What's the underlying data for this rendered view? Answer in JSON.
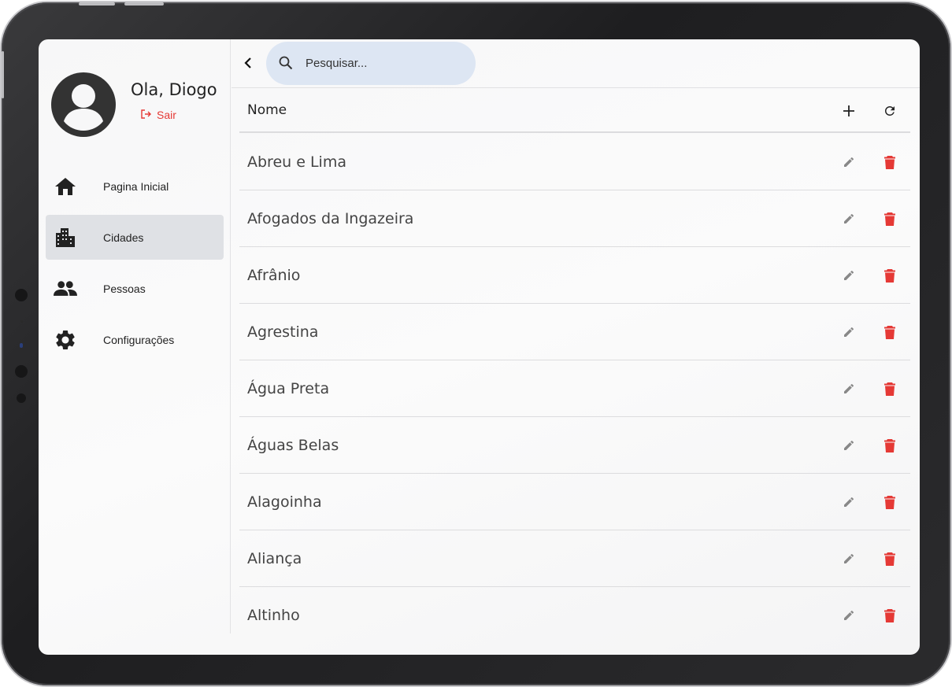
{
  "user": {
    "greeting": "Ola, Diogo",
    "logout_label": "Sair"
  },
  "sidebar": {
    "items": [
      {
        "label": "Pagina Inicial",
        "icon": "home-icon"
      },
      {
        "label": "Cidades",
        "icon": "city-icon",
        "active": true
      },
      {
        "label": "Pessoas",
        "icon": "people-icon"
      },
      {
        "label": "Configurações",
        "icon": "gear-icon"
      }
    ]
  },
  "search": {
    "placeholder": "Pesquisar...",
    "value": ""
  },
  "table": {
    "header": "Nome",
    "rows": [
      "Abreu e Lima",
      "Afogados da Ingazeira",
      "Afrânio",
      "Agrestina",
      "Água Preta",
      "Águas Belas",
      "Alagoinha",
      "Aliança",
      "Altinho"
    ]
  },
  "colors": {
    "accent_danger": "#e53935",
    "search_bg": "#dde6f3",
    "active_nav_bg": "#dfe1e5"
  }
}
